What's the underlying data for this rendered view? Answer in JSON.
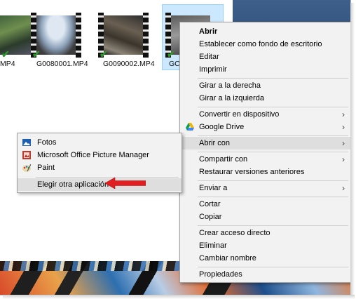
{
  "files": [
    {
      "name": "MP4",
      "checked": true
    },
    {
      "name": "G0080001.MP4",
      "checked": true
    },
    {
      "name": "G0090002.MP4",
      "checked": true
    },
    {
      "name": "GC",
      "checked": true,
      "selected": true
    }
  ],
  "context_menu": {
    "items": [
      {
        "label": "Abrir",
        "bold": true
      },
      {
        "label": "Establecer como fondo de escritorio"
      },
      {
        "label": "Editar"
      },
      {
        "label": "Imprimir"
      },
      {
        "label": "Girar a la derecha"
      },
      {
        "label": "Girar a la izquierda"
      },
      {
        "label": "Convertir en dispositivo",
        "submenu": true
      },
      {
        "label": "Google Drive",
        "submenu": true,
        "icon": "google-drive-icon"
      },
      {
        "label": "Abrir con",
        "submenu": true,
        "highlighted": true
      },
      {
        "label": "Compartir con",
        "submenu": true
      },
      {
        "label": "Restaurar versiones anteriores"
      },
      {
        "label": "Enviar a",
        "submenu": true
      },
      {
        "label": "Cortar"
      },
      {
        "label": "Copiar"
      },
      {
        "label": "Crear acceso directo"
      },
      {
        "label": "Eliminar"
      },
      {
        "label": "Cambiar nombre"
      },
      {
        "label": "Propiedades"
      }
    ],
    "submenu_arrow": "›"
  },
  "open_with_submenu": {
    "items": [
      {
        "label": "Fotos",
        "icon": "photos-icon"
      },
      {
        "label": "Microsoft Office Picture Manager",
        "icon": "picture-manager-icon"
      },
      {
        "label": "Paint",
        "icon": "paint-icon"
      },
      {
        "label": "Elegir otra aplicación",
        "highlighted": true
      }
    ]
  },
  "colors": {
    "menu_bg": "#f2f2f2",
    "highlight": "#dedede",
    "selection": "#cce8ff",
    "callout_arrow": "#e02020",
    "check": "#2a9a2a"
  },
  "check_glyph": "✔"
}
